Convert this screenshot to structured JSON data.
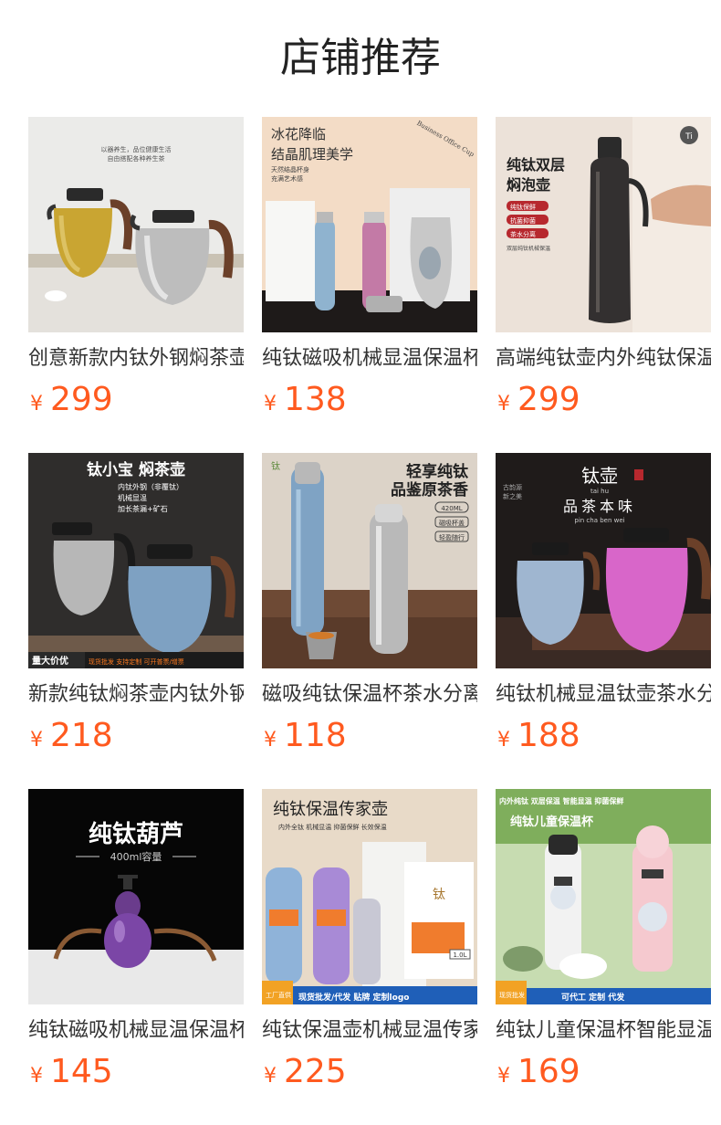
{
  "section_title": "店铺推荐",
  "products": [
    {
      "name": "创意新款内钛外钢焖茶壶",
      "currency": "¥",
      "price": "299",
      "image": {
        "bg": "#e9e9e7",
        "lines": [
          "以器养生，品位健康生活",
          "自由搭配各种养生茶"
        ],
        "badges": []
      }
    },
    {
      "name": "纯钛磁吸机械显温保温杯",
      "currency": "¥",
      "price": "138",
      "image": {
        "bg": "#f1d9c1",
        "lines": [
          "冰花降临",
          "结晶肌理美学",
          "天然结晶杯身",
          "充满艺术感",
          "Business Office Cup"
        ],
        "badges": []
      }
    },
    {
      "name": "高端纯钛壶内外纯钛保温壶",
      "currency": "¥",
      "price": "299",
      "image": {
        "bg": "#e8ded6",
        "lines": [
          "纯钛双层",
          "焖泡壶",
          "纯钛保鲜",
          "抗菌抑菌",
          "茶水分离",
          "双层纯钛机械保温",
          "Ti"
        ],
        "badges": []
      }
    },
    {
      "name": "新款纯钛焖茶壶内钛外钢",
      "currency": "¥",
      "price": "218",
      "image": {
        "bg": "#333333",
        "lines": [
          "钛小宝 焖茶壶",
          "内钛外钢（非覆钛）",
          "机械显温",
          "加长茶漏+矿石",
          "量大价优",
          "现货批发 支持定制 可开普票/增票"
        ],
        "badges": []
      }
    },
    {
      "name": "磁吸纯钛保温杯茶水分离",
      "currency": "¥",
      "price": "118",
      "image": {
        "bg": "#d8cfc4",
        "lines": [
          "轻享纯钛",
          "品鉴原茶香",
          "420ML",
          "磁吸杯盖",
          "轻盈随行",
          "钛"
        ],
        "badges": []
      }
    },
    {
      "name": "纯钛机械显温钛壶茶水分离",
      "currency": "¥",
      "price": "188",
      "image": {
        "bg": "#1f1b1a",
        "lines": [
          "钛壶",
          "品茶本味",
          "pin  cha  ben  wei",
          "tai   hu",
          "古韵源",
          "新之美"
        ],
        "badges": []
      }
    },
    {
      "name": "纯钛磁吸机械显温保温杯",
      "currency": "¥",
      "price": "145",
      "image": {
        "bg": "#050505",
        "lines": [
          "纯钛葫芦",
          "400ml容量"
        ],
        "badges": []
      }
    },
    {
      "name": "纯钛保温壶机械显温传家壶",
      "currency": "¥",
      "price": "225",
      "image": {
        "bg": "#e7d9c6",
        "lines": [
          "纯钛保温传家壶",
          "内外全钛 机械显温 抑菌保鲜 长效保温",
          "钛",
          "工厂直供",
          "现货批发/代发 贴牌 定制logo",
          "1.0L"
        ],
        "badges": []
      }
    },
    {
      "name": "纯钛儿童保温杯智能显温",
      "currency": "¥",
      "price": "169",
      "image": {
        "bg": "#c9dcb4",
        "lines": [
          "内外纯钛  双层保温  智能显温  抑菌保鲜",
          "纯钛儿童保温杯",
          "现货批发",
          "可代工  定制  代发"
        ],
        "badges": []
      }
    }
  ]
}
